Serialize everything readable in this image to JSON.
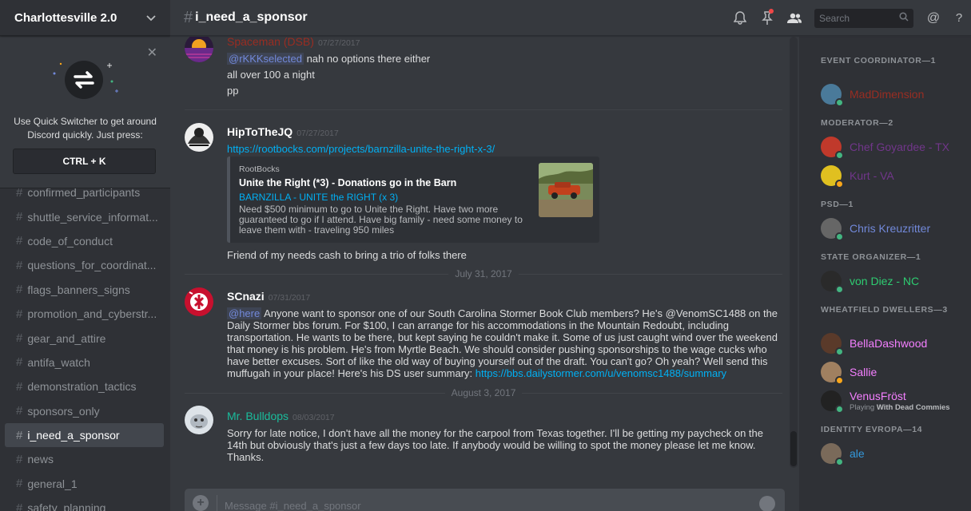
{
  "server": {
    "name": "Charlottesville 2.0"
  },
  "quick_switcher": {
    "text": "Use Quick Switcher to get around Discord quickly. Just press:",
    "shortcut": "CTRL + K"
  },
  "channels": [
    {
      "name": "confirmed_participants",
      "active": false
    },
    {
      "name": "shuttle_service_informat...",
      "active": false
    },
    {
      "name": "code_of_conduct",
      "active": false
    },
    {
      "name": "questions_for_coordinat...",
      "active": false
    },
    {
      "name": "flags_banners_signs",
      "active": false
    },
    {
      "name": "promotion_and_cyberstr...",
      "active": false
    },
    {
      "name": "gear_and_attire",
      "active": false
    },
    {
      "name": "antifa_watch",
      "active": false
    },
    {
      "name": "demonstration_tactics",
      "active": false
    },
    {
      "name": "sponsors_only",
      "active": false
    },
    {
      "name": "i_need_a_sponsor",
      "active": true
    },
    {
      "name": "news",
      "active": false
    },
    {
      "name": "general_1",
      "active": false
    },
    {
      "name": "safety_planning",
      "active": false
    }
  ],
  "header": {
    "channel": "i_need_a_sponsor",
    "search_placeholder": "Search"
  },
  "messages": [
    {
      "author": "Spaceman (DSB)",
      "color": "#992d22",
      "timestamp": "07/27/2017",
      "mention": "@rKKKselected",
      "first_line": " nah no options there either",
      "lines": [
        "all over 100 a night",
        "pp"
      ]
    },
    {
      "author": "HipToTheJQ",
      "color": "#ffffff",
      "timestamp": "07/27/2017",
      "link": "https://rootbocks.com/projects/barnzilla-unite-the-right-x-3/",
      "embed": {
        "provider": "RootBocks",
        "title": "Unite the Right (*3) - Donations go in the Barn",
        "subtitle": "BARNZILLA - UNITE the RIGHT (x 3)",
        "description": "Need $500 minimum to go to Unite the Right. Have two more guaranteed to go if I attend. Have big family - need some money to leave them with - traveling 950 miles"
      },
      "after_text": "Friend of my needs cash to bring a trio of folks there"
    },
    {
      "divider": "July 31, 2017"
    },
    {
      "author": "SCnazi",
      "color": "#ffffff",
      "timestamp": "07/31/2017",
      "mention": "@here",
      "text": " Anyone want to sponsor one of our South Carolina Stormer Book Club members? He's @VenomSC1488 on the Daily Stormer bbs forum. For $100, I can arrange for his accommodations in the Mountain Redoubt, including transportation. He wants to be there, but kept saying he couldn't make it. Some of us just caught wind over the weekend that money is his problem. He's from Myrtle Beach. We should consider pushing sponsorships to the wage cucks who have better excuses. Sort of like the old way of buying yourself out of the draft. You can't go? Oh yeah? Well send this muffugah in your place! Here's his DS user summary: ",
      "link": "https://bbs.dailystormer.com/u/venomsc1488/summary"
    },
    {
      "divider": "August 3, 2017"
    },
    {
      "author": "Mr. Bulldops",
      "color": "#1abc9c",
      "timestamp": "08/03/2017",
      "text": "Sorry for late notice, I don't have all the money for the carpool from Texas together. I'll be getting my paycheck on the 14th but obviously that's just a few days too late. If anybody would be willing to spot the money please let me know. Thanks."
    }
  ],
  "composer": {
    "placeholder": "Message #i_need_a_sponsor"
  },
  "member_groups": [
    {
      "role": "EVENT COORDINATOR—1",
      "members": [
        {
          "name": "MadDimension",
          "color": "#992d22",
          "status": "online"
        }
      ]
    },
    {
      "role": "MODERATOR—2",
      "members": [
        {
          "name": "Chef Goyardee - TX",
          "color": "#71368a",
          "status": "online"
        },
        {
          "name": "Kurt - VA",
          "color": "#71368a",
          "status": "idle"
        }
      ]
    },
    {
      "role": "PSD—1",
      "members": [
        {
          "name": "Chris Kreuzritter",
          "color": "#7289da",
          "status": "online"
        }
      ]
    },
    {
      "role": "STATE ORGANIZER—1",
      "members": [
        {
          "name": "von Diez - NC",
          "color": "#2ecc71",
          "status": "online"
        }
      ]
    },
    {
      "role": "WHEATFIELD DWELLERS—3",
      "members": [
        {
          "name": "BellaDashwood",
          "color": "#f47fff",
          "status": "online"
        },
        {
          "name": "Sallie",
          "color": "#f47fff",
          "status": "idle"
        },
        {
          "name": "VenusFröst",
          "color": "#f47fff",
          "status": "online",
          "game": "With Dead Commies",
          "game_prefix": "Playing"
        }
      ]
    },
    {
      "role": "IDENTITY EVROPA—14",
      "members": [
        {
          "name": "ale",
          "color": "#3498db",
          "status": "online"
        }
      ]
    }
  ]
}
